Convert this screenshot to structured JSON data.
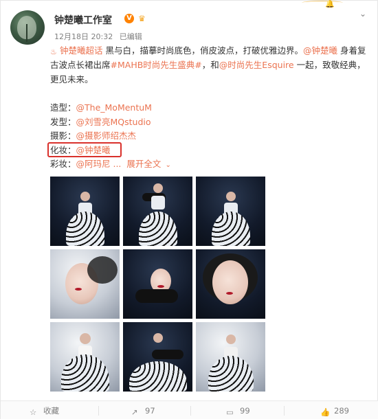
{
  "post": {
    "author_name": "钟楚曦工作室",
    "verified_badge": "V",
    "date": "12月18日 20:32",
    "edited": "已编辑",
    "text": {
      "fire_label": "钟楚曦超话",
      "p1": " 黑与白，描摹时尚底色，俏皮波点，打破优雅边界。",
      "mention1": "@钟楚曦",
      "p2": " 身着复古波点长裙出席",
      "topic1": "#MAHB时尚先生盛典#",
      "p3": "，和",
      "mention2": "@时尚先生Esquire",
      "p4": " 一起，致敬经典，更见未来。"
    },
    "credits": [
      {
        "label": "造型：",
        "value": "@The_MoMentuM"
      },
      {
        "label": "发型：",
        "value": "@刘雪亮MQstudio"
      },
      {
        "label": "摄影：",
        "value": "@摄影师绍杰杰"
      },
      {
        "label": "化妆：",
        "value": "@钟楚曦"
      },
      {
        "label": "彩妆：",
        "value": "@阿玛尼 ..."
      }
    ],
    "expand_label": "展开全文",
    "photos": [
      {
        "name": "photo-1"
      },
      {
        "name": "photo-2"
      },
      {
        "name": "photo-3"
      },
      {
        "name": "photo-4"
      },
      {
        "name": "photo-5"
      },
      {
        "name": "photo-6"
      },
      {
        "name": "photo-7"
      },
      {
        "name": "photo-8"
      },
      {
        "name": "photo-9"
      }
    ]
  },
  "actions": {
    "favorite_label": "收藏",
    "repost_count": "97",
    "comment_count": "99",
    "like_count": "289"
  },
  "colors": {
    "accent": "#eb7350",
    "highlight_box": "#d9302b",
    "verified": "#ff8200"
  }
}
